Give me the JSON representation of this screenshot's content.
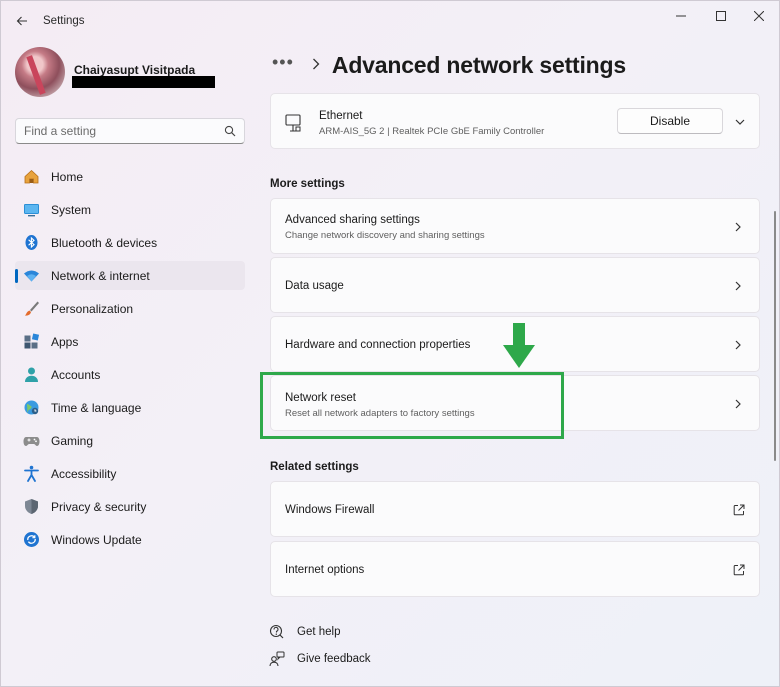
{
  "window": {
    "title": "Settings"
  },
  "profile": {
    "name": "Chaiyasupt Visitpada"
  },
  "search": {
    "placeholder": "Find a setting"
  },
  "sidebar": {
    "items": [
      {
        "label": "Home",
        "icon": "home-icon"
      },
      {
        "label": "System",
        "icon": "system-icon"
      },
      {
        "label": "Bluetooth & devices",
        "icon": "bluetooth-icon"
      },
      {
        "label": "Network & internet",
        "icon": "wifi-icon",
        "active": true
      },
      {
        "label": "Personalization",
        "icon": "brush-icon"
      },
      {
        "label": "Apps",
        "icon": "apps-icon"
      },
      {
        "label": "Accounts",
        "icon": "account-icon"
      },
      {
        "label": "Time & language",
        "icon": "globe-icon"
      },
      {
        "label": "Gaming",
        "icon": "gamepad-icon"
      },
      {
        "label": "Accessibility",
        "icon": "accessibility-icon"
      },
      {
        "label": "Privacy & security",
        "icon": "shield-icon"
      },
      {
        "label": "Windows Update",
        "icon": "update-icon"
      }
    ]
  },
  "header": {
    "more": "•••",
    "title": "Advanced network settings"
  },
  "ethernet": {
    "title": "Ethernet",
    "subtitle": "ARM-AIS_5G 2 | Realtek PCIe GbE Family Controller",
    "button": "Disable"
  },
  "more_settings": {
    "label": "More settings",
    "items": [
      {
        "title": "Advanced sharing settings",
        "subtitle": "Change network discovery and sharing settings"
      },
      {
        "title": "Data usage",
        "subtitle": ""
      },
      {
        "title": "Hardware and connection properties",
        "subtitle": ""
      },
      {
        "title": "Network reset",
        "subtitle": "Reset all network adapters to factory settings"
      }
    ]
  },
  "related_settings": {
    "label": "Related settings",
    "items": [
      {
        "title": "Windows Firewall"
      },
      {
        "title": "Internet options"
      }
    ]
  },
  "footer": {
    "help": "Get help",
    "feedback": "Give feedback"
  },
  "colors": {
    "accent": "#0067c0",
    "highlight": "#2ea84a"
  }
}
